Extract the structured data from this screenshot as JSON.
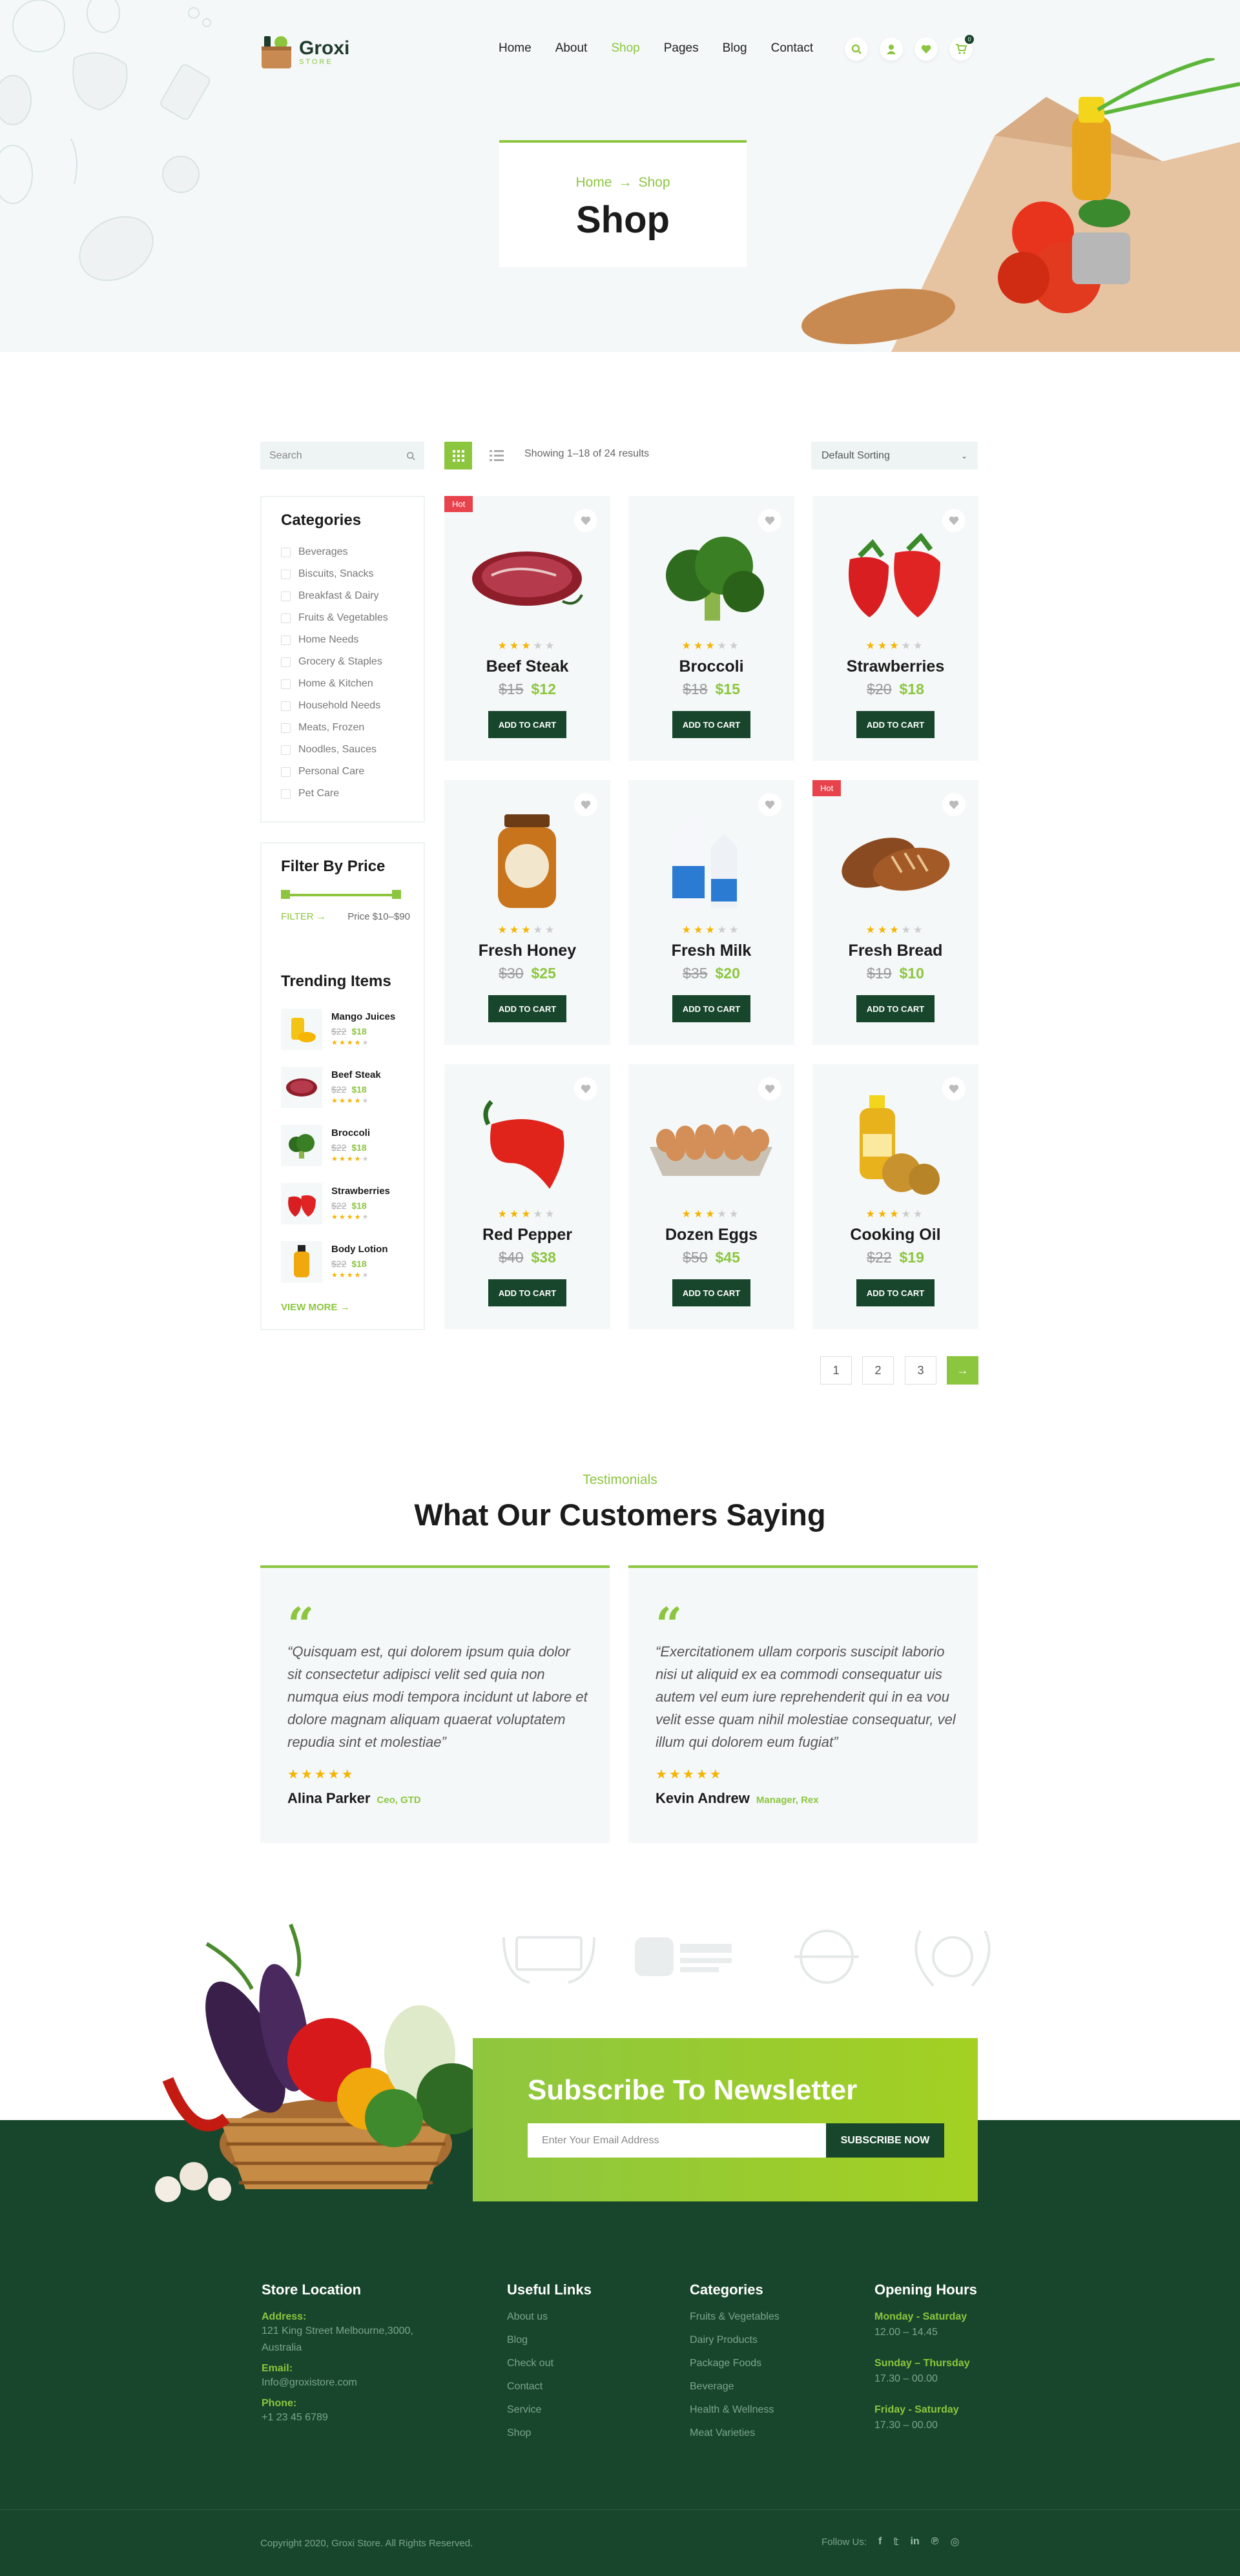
{
  "brand": {
    "name": "Groxi",
    "tagline": "STORE",
    "accent": "#8cc63f",
    "dark": "#18462c"
  },
  "nav": {
    "items": [
      {
        "label": "Home"
      },
      {
        "label": "About"
      },
      {
        "label": "Shop",
        "active": true
      },
      {
        "label": "Pages"
      },
      {
        "label": "Blog"
      },
      {
        "label": "Contact"
      }
    ],
    "cart_count": "0"
  },
  "hero": {
    "crumb_home": "Home",
    "crumb_current": "Shop",
    "title": "Shop"
  },
  "toolbar": {
    "search_placeholder": "Search",
    "showing": "Showing 1–18 of 24 results",
    "sort": "Default Sorting"
  },
  "categories": {
    "title": "Categories",
    "items": [
      "Beverages",
      "Biscuits, Snacks",
      "Breakfast & Dairy",
      "Fruits & Vegetables",
      "Home Needs",
      "Grocery & Staples",
      "Home & Kitchen",
      "Household Needs",
      "Meats, Frozen",
      "Noodles, Sauces",
      "Personal Care",
      "Pet Care"
    ]
  },
  "price_filter": {
    "title": "Filter By Price",
    "button": "FILTER",
    "range": "Price $10–$90"
  },
  "trending": {
    "title": "Trending Items",
    "view_more": "VIEW MORE",
    "items": [
      {
        "name": "Mango Juices",
        "old": "$22",
        "new": "$18"
      },
      {
        "name": "Beef Steak",
        "old": "$22",
        "new": "$18"
      },
      {
        "name": "Broccoli",
        "old": "$22",
        "new": "$18"
      },
      {
        "name": "Strawberries",
        "old": "$22",
        "new": "$18"
      },
      {
        "name": "Body Lotion",
        "old": "$22",
        "new": "$18"
      }
    ]
  },
  "products": {
    "add_label": "ADD TO CART",
    "hot_label": "Hot",
    "items": [
      {
        "name": "Beef Steak",
        "old": "$15",
        "new": "$12",
        "hot": true,
        "rating": 3
      },
      {
        "name": "Broccoli",
        "old": "$18",
        "new": "$15",
        "hot": false,
        "rating": 3
      },
      {
        "name": "Strawberries",
        "old": "$20",
        "new": "$18",
        "hot": false,
        "rating": 3
      },
      {
        "name": "Fresh Honey",
        "old": "$30",
        "new": "$25",
        "hot": false,
        "rating": 3
      },
      {
        "name": "Fresh Milk",
        "old": "$35",
        "new": "$20",
        "hot": false,
        "rating": 3
      },
      {
        "name": "Fresh Bread",
        "old": "$19",
        "new": "$10",
        "hot": true,
        "rating": 3
      },
      {
        "name": "Red Pepper",
        "old": "$40",
        "new": "$38",
        "hot": false,
        "rating": 3
      },
      {
        "name": "Dozen Eggs",
        "old": "$50",
        "new": "$45",
        "hot": false,
        "rating": 3
      },
      {
        "name": "Cooking Oil",
        "old": "$22",
        "new": "$19",
        "hot": false,
        "rating": 3
      }
    ]
  },
  "pagination": {
    "pages": [
      "1",
      "2",
      "3"
    ]
  },
  "testimonials": {
    "subtitle": "Testimonials",
    "title": "What Our Customers Saying",
    "items": [
      {
        "text": "“Quisquam est, qui dolorem ipsum quia dolor sit consectetur adipisci velit sed quia non numqua eius modi tempora incidunt ut labore et dolore magnam aliquam quaerat voluptatem repudia sint et molestiae”",
        "author": "Alina Parker",
        "role": "Ceo, GTD"
      },
      {
        "text": "“Exercitationem ullam corporis suscipit laborio nisi ut aliquid ex ea commodi consequatur uis autem vel eum iure reprehenderit qui in ea vou velit esse quam nihil molestiae consequatur, vel illum qui dolorem eum fugiat”",
        "author": "Kevin Andrew",
        "role": "Manager, Rex"
      }
    ]
  },
  "newsletter": {
    "title": "Subscribe To Newsletter",
    "placeholder": "Enter Your Email Address",
    "button": "SUBSCRIBE NOW"
  },
  "footer": {
    "location": {
      "title": "Store Location",
      "address_label": "Address:",
      "address": "121 King Street Melbourne,3000, Australia",
      "email_label": "Email:",
      "email": "Info@groxistore.com",
      "phone_label": "Phone:",
      "phone": "+1 23 45 6789"
    },
    "links": {
      "title": "Useful Links",
      "items": [
        "About us",
        "Blog",
        "Check out",
        "Contact",
        "Service",
        "Shop"
      ]
    },
    "categories": {
      "title": "Categories",
      "items": [
        "Fruits & Vegetables",
        "Dairy Products",
        "Package Foods",
        "Beverage",
        "Health & Wellness",
        "Meat Varieties"
      ]
    },
    "hours": {
      "title": "Opening Hours",
      "items": [
        {
          "day": "Monday - Saturday",
          "time": "12.00 – 14.45"
        },
        {
          "day": "Sunday – Thursday",
          "time": "17.30 – 00.00"
        },
        {
          "day": "Friday - Saturday",
          "time": "17.30 – 00.00"
        }
      ]
    },
    "copyright": "Copyright 2020, Groxi Store. All Rights Reserved.",
    "follow": "Follow Us:",
    "social_icons": [
      "facebook-icon",
      "twitter-icon",
      "linkedin-icon",
      "pinterest-icon",
      "instagram-icon"
    ]
  }
}
